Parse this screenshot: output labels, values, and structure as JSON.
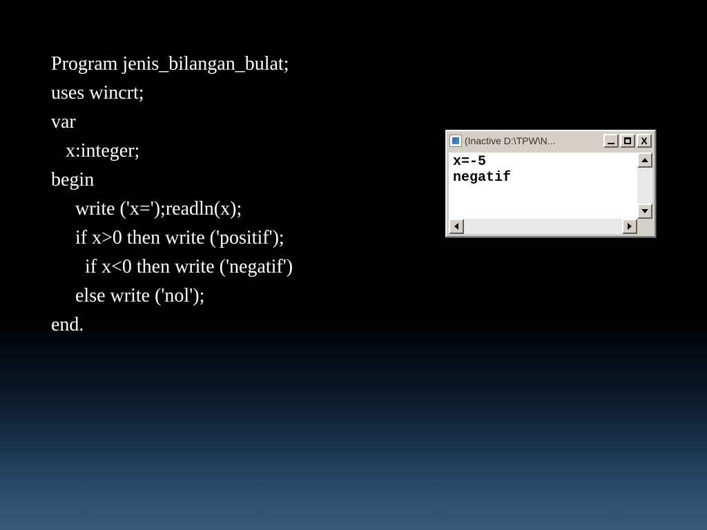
{
  "code": {
    "l1": "Program jenis_bilangan_bulat;",
    "l2": "uses wincrt;",
    "l3": "var",
    "l4": "   x:integer;",
    "l5": "begin",
    "l6": "     write ('x=');readln(x);",
    "l7": "     if x>0 then write ('positif');",
    "l8": "       if x<0 then write ('negatif')",
    "l9": "     else write ('nol');",
    "l10": "end."
  },
  "console": {
    "title": "(Inactive D:\\TPW\\N...",
    "line1": "x=-5",
    "line2": "negatif"
  }
}
